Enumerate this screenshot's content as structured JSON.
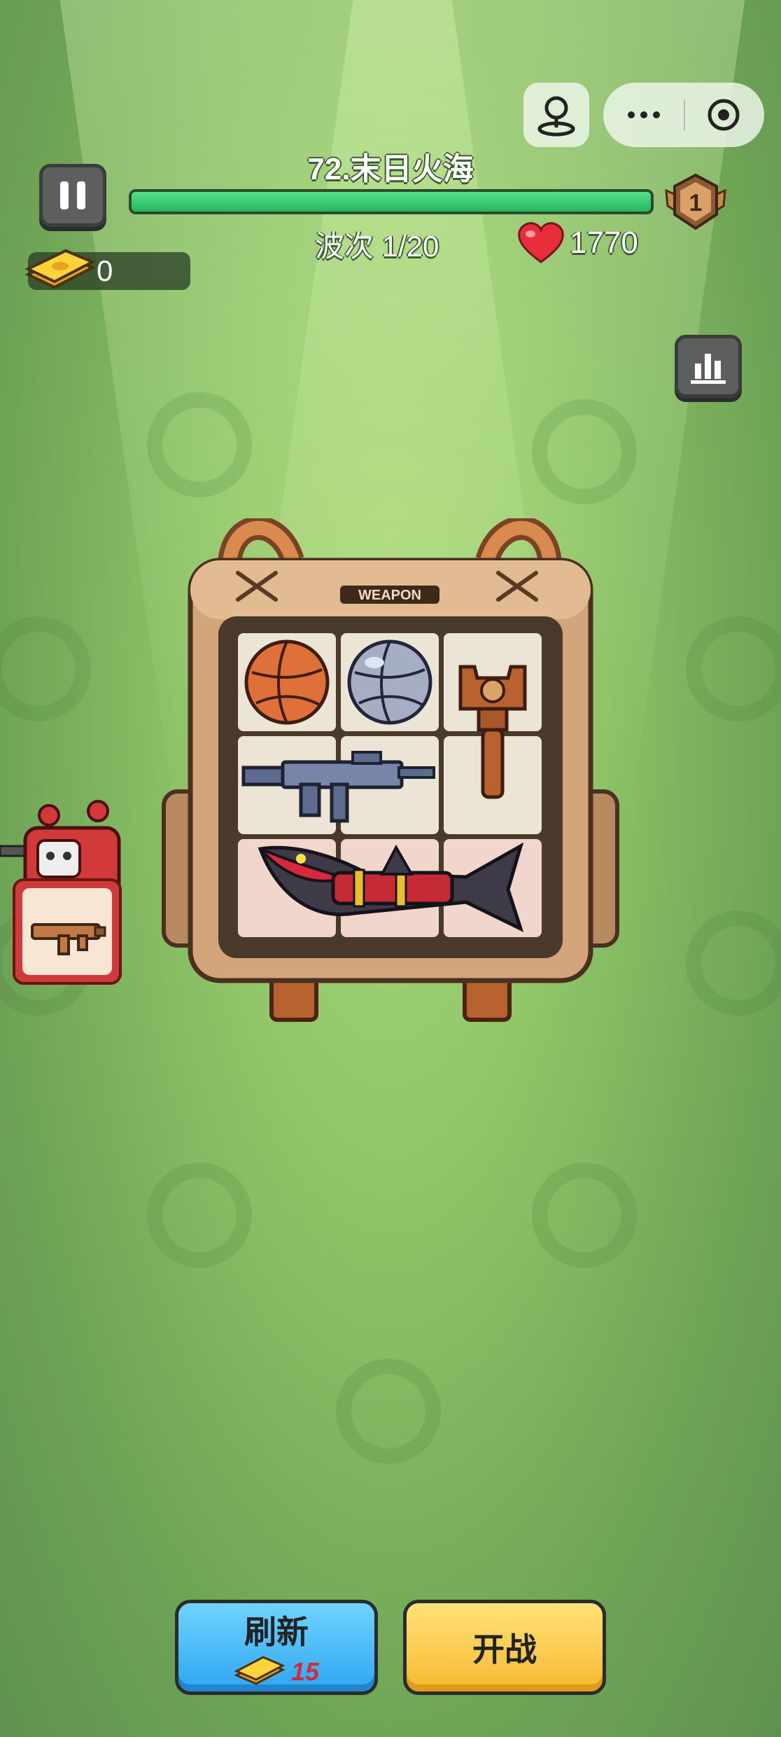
{
  "header": {
    "level_title": "72.末日火海",
    "wave_text": "波次 1/20",
    "health": "1770",
    "rank_badge": "1",
    "wave_progress": 1.0
  },
  "currency": {
    "gold": "0"
  },
  "backpack": {
    "tag": "WEAPON",
    "items": [
      "basketball",
      "steel-ball",
      "wooden-club",
      "assault-rifle",
      "shark-launcher"
    ]
  },
  "side_item": {
    "name": "smg"
  },
  "buttons": {
    "refresh_label": "刷新",
    "refresh_cost": "15",
    "fight_label": "开战"
  },
  "colors": {
    "progress": "#2fcf6e",
    "refresh": "#3bb6f5",
    "fight": "#f7c53c",
    "heart": "#e82e3c"
  }
}
